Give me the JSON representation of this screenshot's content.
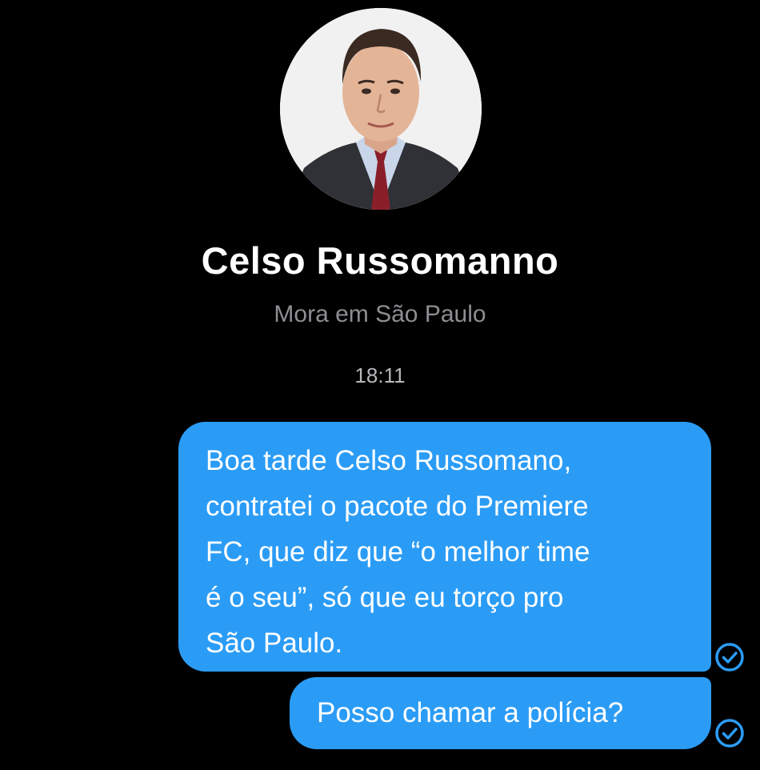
{
  "profile": {
    "name": "Celso Russomanno",
    "subtitle": "Mora em São Paulo",
    "avatar_icon": "profile-photo"
  },
  "conversation": {
    "timestamp": "18:11",
    "messages": [
      {
        "lines": [
          "Boa tarde Celso Russomano,",
          "contratei o pacote do Premiere",
          "FC, que diz que “o melhor time",
          "é o seu”, só que eu torço pro",
          "São Paulo."
        ],
        "status_icon": "check-circle-icon"
      },
      {
        "lines": [
          "Posso chamar a polícia?"
        ],
        "status_icon": "check-circle-icon"
      }
    ]
  },
  "colors": {
    "background": "#000000",
    "bubble": "#2b9cf6",
    "subtitle": "#8e8e93",
    "receipt": "#2b9cf6"
  }
}
